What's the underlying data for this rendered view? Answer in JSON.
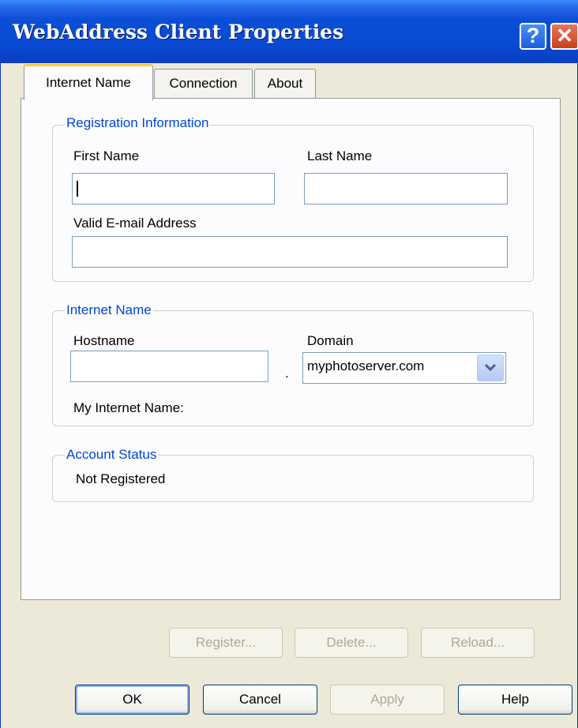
{
  "window": {
    "title": "WebAddress Client Properties",
    "help_symbol": "?",
    "close_symbol": "✕"
  },
  "tabs": [
    "Internet Name",
    "Connection",
    "About"
  ],
  "active_tab": "Internet Name",
  "registration": {
    "title": "Registration Information",
    "first_name_label": "First Name",
    "first_name_value": "",
    "last_name_label": "Last Name",
    "last_name_value": "",
    "email_label": "Valid E-mail Address",
    "email_value": ""
  },
  "internet_name": {
    "title": "Internet Name",
    "hostname_label": "Hostname",
    "hostname_value": "",
    "separator": ".",
    "domain_label": "Domain",
    "domain_value": "myphotoserver.com",
    "my_internet_name_label": "My Internet Name:"
  },
  "account_status": {
    "title": "Account Status",
    "value": "Not Registered"
  },
  "panel_buttons": {
    "register": "Register...",
    "delete": "Delete...",
    "reload": "Reload..."
  },
  "dialog_buttons": {
    "ok": "OK",
    "cancel": "Cancel",
    "apply": "Apply",
    "help": "Help"
  }
}
